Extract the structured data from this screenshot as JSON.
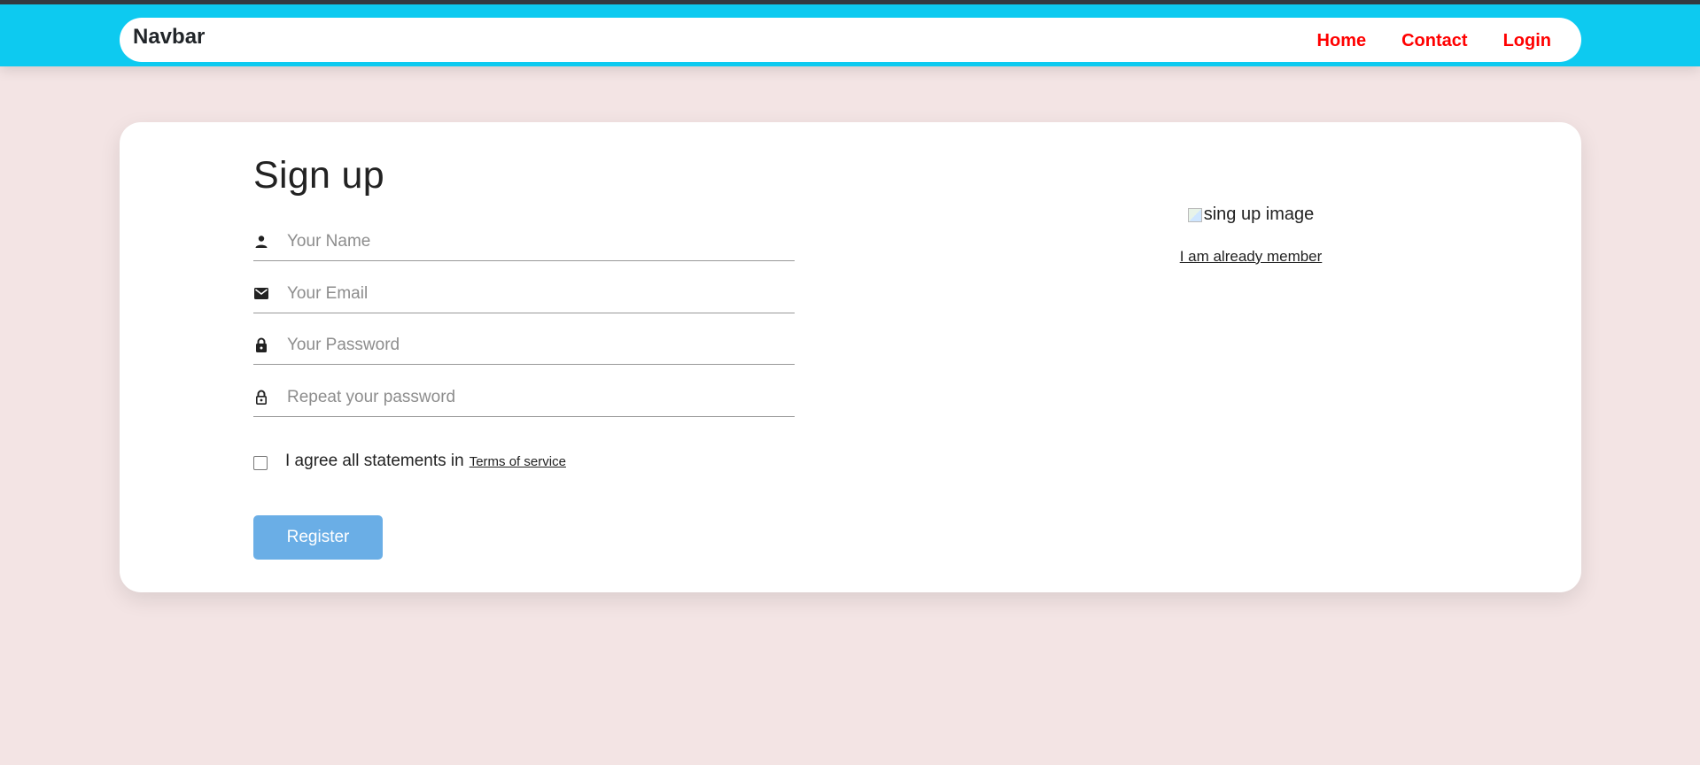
{
  "navbar": {
    "brand": "Navbar",
    "links": [
      {
        "label": "Home"
      },
      {
        "label": "Contact"
      },
      {
        "label": "Login"
      }
    ]
  },
  "form": {
    "title": "Sign up",
    "fields": [
      {
        "icon": "person-icon",
        "placeholder": "Your Name",
        "value": ""
      },
      {
        "icon": "email-icon",
        "placeholder": "Your Email",
        "value": ""
      },
      {
        "icon": "lock-icon",
        "placeholder": "Your Password",
        "value": ""
      },
      {
        "icon": "lock-outline-icon",
        "placeholder": "Repeat your password",
        "value": ""
      }
    ],
    "agree_text": "I agree all statements in",
    "terms_link": "Terms of service",
    "agree_checked": false,
    "register_label": "Register"
  },
  "side": {
    "image_alt": "sing up image",
    "member_link": "I am already member"
  },
  "colors": {
    "topbar": "#0dcaf0",
    "nav_link": "#ff0000",
    "page_bg": "#f3e4e4",
    "register_button": "#6aaee6"
  }
}
